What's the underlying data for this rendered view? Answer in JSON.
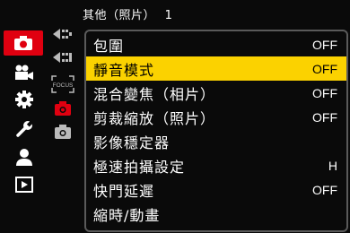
{
  "header": {
    "title": "其他（照片）",
    "page": "1"
  },
  "main_tabs": [
    {
      "icon": "camera-icon",
      "active": true
    },
    {
      "icon": "video-camera-icon",
      "active": false
    },
    {
      "icon": "gear-icon",
      "active": false
    },
    {
      "icon": "wrench-icon",
      "active": false
    },
    {
      "icon": "person-icon",
      "active": false
    },
    {
      "icon": "play-icon",
      "active": false
    }
  ],
  "sub_tabs": [
    {
      "icon": "burst-icon"
    },
    {
      "icon": "burst-alt-icon"
    },
    {
      "icon": "focus-icon",
      "text": "FOCUS"
    },
    {
      "icon": "other-photo-icon",
      "active": true
    },
    {
      "icon": "other-photo-alt-icon"
    }
  ],
  "menu": [
    {
      "label": "包圍",
      "value": "OFF",
      "selected": false
    },
    {
      "label": "靜音模式",
      "value": "OFF",
      "selected": true
    },
    {
      "label": "混合變焦（相片）",
      "value": "OFF",
      "selected": false
    },
    {
      "label": "剪裁縮放（照片）",
      "value": "OFF",
      "selected": false
    },
    {
      "label": "影像穩定器",
      "value": "",
      "selected": false
    },
    {
      "label": "極速拍攝設定",
      "value": "H",
      "selected": false
    },
    {
      "label": "快門延遲",
      "value": "OFF",
      "selected": false
    },
    {
      "label": "縮時/動畫",
      "value": "",
      "selected": false
    }
  ],
  "colors": {
    "selected": "#fbd200",
    "active_tab": "#e00010",
    "active_icon": "#e00010"
  }
}
